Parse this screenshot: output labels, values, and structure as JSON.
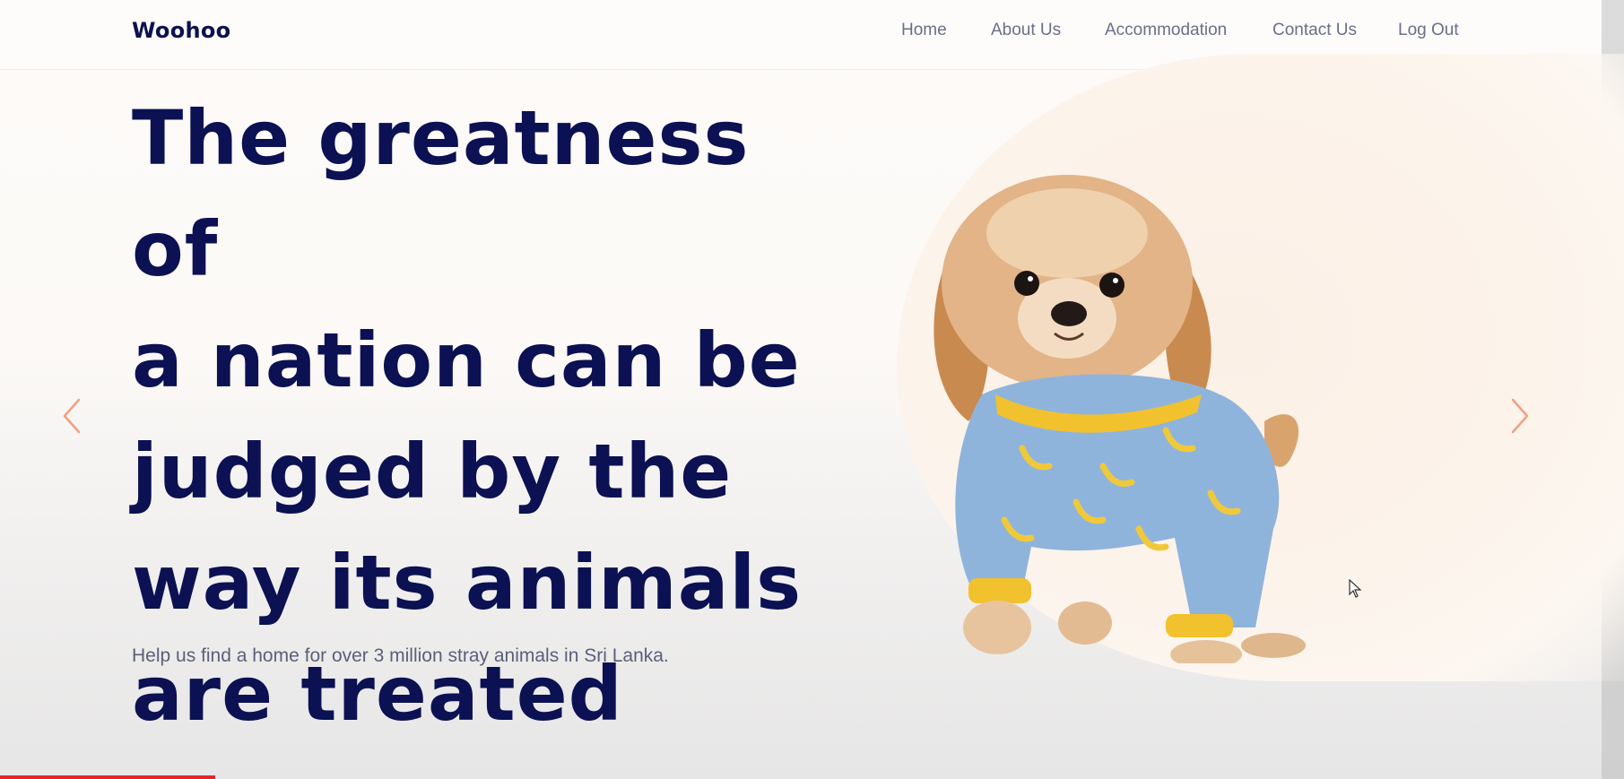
{
  "brand": "Woohoo",
  "nav": {
    "home": "Home",
    "about": "About Us",
    "accommodation": "Accommodation",
    "contact": "Contact Us",
    "logout": "Log Out"
  },
  "hero": {
    "line1": "The greatness of",
    "line2": "a nation can be",
    "line3": "judged by the",
    "line4": "way its animals",
    "line5": "are treated",
    "subtitle": "Help us find a home for over 3 million stray animals in Sri Lanka."
  },
  "icons": {
    "prev": "chevron-left-icon",
    "next": "chevron-right-icon"
  },
  "colors": {
    "headline": "#0b1153",
    "accent_arrow": "#f0a080",
    "nav_text": "#6a6f86"
  }
}
